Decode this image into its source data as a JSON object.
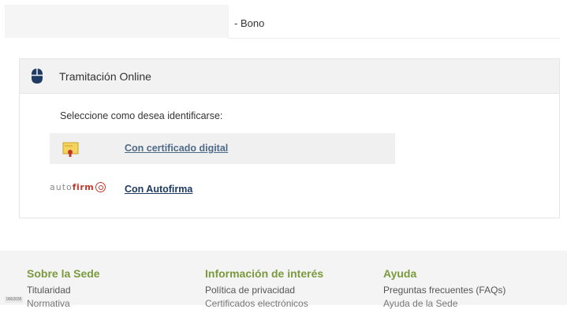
{
  "top": {
    "text": "- Bono"
  },
  "panel": {
    "title": "Tramitación Online",
    "prompt": "Seleccione como desea identificarse:",
    "options": [
      {
        "label": "Con certificado digital",
        "icon": "certificate-icon"
      },
      {
        "label": "Con Autofirma",
        "logo_text_light": "auto",
        "logo_text_bold": "firm",
        "icon": "autofirma-logo"
      }
    ]
  },
  "footer": {
    "columns": [
      {
        "title": "Sobre la Sede",
        "links": [
          "Titularidad",
          "Normativa"
        ]
      },
      {
        "title": "Información de interés",
        "links": [
          "Política de privacidad",
          "Certificados electrónicos"
        ]
      },
      {
        "title": "Ayuda",
        "links": [
          "Preguntas frecuentes (FAQs)",
          "Ayuda de la Sede"
        ]
      }
    ],
    "badge": "0002035"
  },
  "colors": {
    "footer_title": "#7a9a3d",
    "link": "#1f3b63",
    "autofirma_red": "#c0392b"
  }
}
